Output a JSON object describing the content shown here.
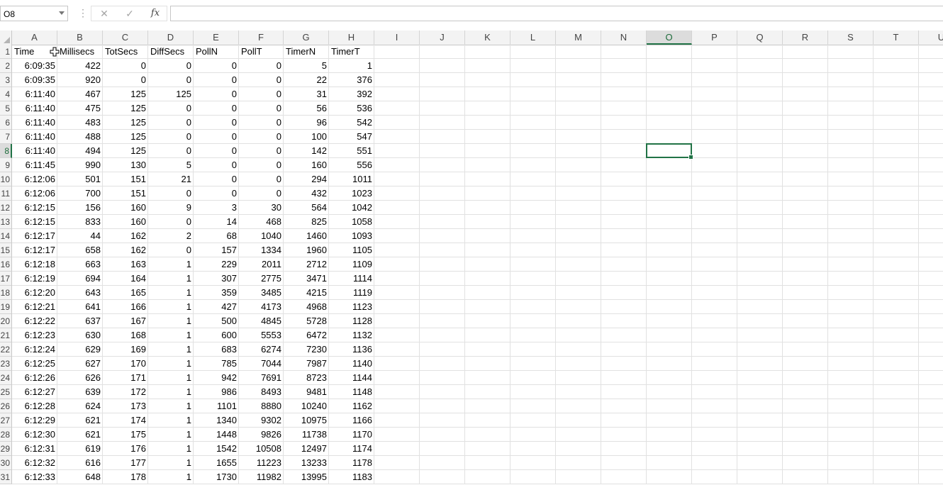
{
  "formula_bar": {
    "name_box": "O8",
    "formula": "",
    "cancel_icon": "x-icon",
    "enter_icon": "check-icon",
    "fx_label": "fx"
  },
  "selected_cell": {
    "column": "O",
    "row": 8
  },
  "columns": [
    "A",
    "B",
    "C",
    "D",
    "E",
    "F",
    "G",
    "H",
    "I",
    "J",
    "K",
    "L",
    "M",
    "N",
    "O",
    "P",
    "Q",
    "R",
    "S",
    "T",
    "U"
  ],
  "header_row": [
    "Time",
    "Millisecs",
    "TotSecs",
    "DiffSecs",
    "PollN",
    "PollT",
    "TimerN",
    "TimerT"
  ],
  "rows": [
    [
      "6:09:35",
      "422",
      "0",
      "0",
      "0",
      "0",
      "5",
      "1"
    ],
    [
      "6:09:35",
      "920",
      "0",
      "0",
      "0",
      "0",
      "22",
      "376"
    ],
    [
      "6:11:40",
      "467",
      "125",
      "125",
      "0",
      "0",
      "31",
      "392"
    ],
    [
      "6:11:40",
      "475",
      "125",
      "0",
      "0",
      "0",
      "56",
      "536"
    ],
    [
      "6:11:40",
      "483",
      "125",
      "0",
      "0",
      "0",
      "96",
      "542"
    ],
    [
      "6:11:40",
      "488",
      "125",
      "0",
      "0",
      "0",
      "100",
      "547"
    ],
    [
      "6:11:40",
      "494",
      "125",
      "0",
      "0",
      "0",
      "142",
      "551"
    ],
    [
      "6:11:45",
      "990",
      "130",
      "5",
      "0",
      "0",
      "160",
      "556"
    ],
    [
      "6:12:06",
      "501",
      "151",
      "21",
      "0",
      "0",
      "294",
      "1011"
    ],
    [
      "6:12:06",
      "700",
      "151",
      "0",
      "0",
      "0",
      "432",
      "1023"
    ],
    [
      "6:12:15",
      "156",
      "160",
      "9",
      "3",
      "30",
      "564",
      "1042"
    ],
    [
      "6:12:15",
      "833",
      "160",
      "0",
      "14",
      "468",
      "825",
      "1058"
    ],
    [
      "6:12:17",
      "44",
      "162",
      "2",
      "68",
      "1040",
      "1460",
      "1093"
    ],
    [
      "6:12:17",
      "658",
      "162",
      "0",
      "157",
      "1334",
      "1960",
      "1105"
    ],
    [
      "6:12:18",
      "663",
      "163",
      "1",
      "229",
      "2011",
      "2712",
      "1109"
    ],
    [
      "6:12:19",
      "694",
      "164",
      "1",
      "307",
      "2775",
      "3471",
      "1114"
    ],
    [
      "6:12:20",
      "643",
      "165",
      "1",
      "359",
      "3485",
      "4215",
      "1119"
    ],
    [
      "6:12:21",
      "641",
      "166",
      "1",
      "427",
      "4173",
      "4968",
      "1123"
    ],
    [
      "6:12:22",
      "637",
      "167",
      "1",
      "500",
      "4845",
      "5728",
      "1128"
    ],
    [
      "6:12:23",
      "630",
      "168",
      "1",
      "600",
      "5553",
      "6472",
      "1132"
    ],
    [
      "6:12:24",
      "629",
      "169",
      "1",
      "683",
      "6274",
      "7230",
      "1136"
    ],
    [
      "6:12:25",
      "627",
      "170",
      "1",
      "785",
      "7044",
      "7987",
      "1140"
    ],
    [
      "6:12:26",
      "626",
      "171",
      "1",
      "942",
      "7691",
      "8723",
      "1144"
    ],
    [
      "6:12:27",
      "639",
      "172",
      "1",
      "986",
      "8493",
      "9481",
      "1148"
    ],
    [
      "6:12:28",
      "624",
      "173",
      "1",
      "1101",
      "8880",
      "10240",
      "1162"
    ],
    [
      "6:12:29",
      "621",
      "174",
      "1",
      "1340",
      "9302",
      "10975",
      "1166"
    ],
    [
      "6:12:30",
      "621",
      "175",
      "1",
      "1448",
      "9826",
      "11738",
      "1170"
    ],
    [
      "6:12:31",
      "619",
      "176",
      "1",
      "1542",
      "10508",
      "12497",
      "1174"
    ],
    [
      "6:12:32",
      "616",
      "177",
      "1",
      "1655",
      "11223",
      "13233",
      "1178"
    ],
    [
      "6:12:33",
      "648",
      "178",
      "1",
      "1730",
      "11982",
      "13995",
      "1183"
    ]
  ],
  "row_numbers": [
    "1",
    "2",
    "3",
    "4",
    "5",
    "6",
    "7",
    "8",
    "9",
    "10",
    "11",
    "12",
    "13",
    "14",
    "15",
    "16",
    "17",
    "18",
    "19",
    "20",
    "21",
    "22",
    "23",
    "24",
    "25",
    "26",
    "27",
    "28",
    "29",
    "30",
    "31"
  ],
  "colors": {
    "accent": "#217346",
    "gridline": "#e1e1e1",
    "header_bg": "#f3f3f3"
  }
}
